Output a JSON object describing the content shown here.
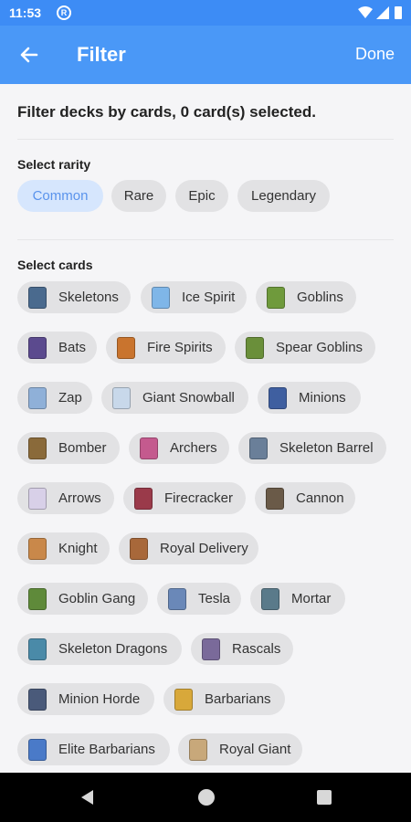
{
  "status_bar": {
    "time": "11:53"
  },
  "app_bar": {
    "title": "Filter",
    "done_label": "Done"
  },
  "filter_summary": "Filter decks by cards, 0 card(s) selected.",
  "rarity": {
    "label": "Select rarity",
    "options": [
      "Common",
      "Rare",
      "Epic",
      "Legendary"
    ],
    "selected": "Common"
  },
  "cards": {
    "label": "Select cards",
    "items": [
      {
        "name": "Skeletons",
        "icon": "skeletons-card-icon"
      },
      {
        "name": "Ice Spirit",
        "icon": "ice-spirit-card-icon"
      },
      {
        "name": "Goblins",
        "icon": "goblins-card-icon"
      },
      {
        "name": "Bats",
        "icon": "bats-card-icon"
      },
      {
        "name": "Fire Spirits",
        "icon": "fire-spirits-card-icon"
      },
      {
        "name": "Spear Goblins",
        "icon": "spear-goblins-card-icon"
      },
      {
        "name": "Zap",
        "icon": "zap-card-icon"
      },
      {
        "name": "Giant Snowball",
        "icon": "giant-snowball-card-icon"
      },
      {
        "name": "Minions",
        "icon": "minions-card-icon"
      },
      {
        "name": "Bomber",
        "icon": "bomber-card-icon"
      },
      {
        "name": "Archers",
        "icon": "archers-card-icon"
      },
      {
        "name": "Skeleton Barrel",
        "icon": "skeleton-barrel-card-icon"
      },
      {
        "name": "Arrows",
        "icon": "arrows-card-icon"
      },
      {
        "name": "Firecracker",
        "icon": "firecracker-card-icon"
      },
      {
        "name": "Cannon",
        "icon": "cannon-card-icon"
      },
      {
        "name": "Knight",
        "icon": "knight-card-icon"
      },
      {
        "name": "Royal Delivery",
        "icon": "royal-delivery-card-icon"
      },
      {
        "name": "Goblin Gang",
        "icon": "goblin-gang-card-icon"
      },
      {
        "name": "Tesla",
        "icon": "tesla-card-icon"
      },
      {
        "name": "Mortar",
        "icon": "mortar-card-icon"
      },
      {
        "name": "Skeleton Dragons",
        "icon": "skeleton-dragons-card-icon"
      },
      {
        "name": "Rascals",
        "icon": "rascals-card-icon"
      },
      {
        "name": "Minion Horde",
        "icon": "minion-horde-card-icon"
      },
      {
        "name": "Barbarians",
        "icon": "barbarians-card-icon"
      },
      {
        "name": "Elite Barbarians",
        "icon": "elite-barbarians-card-icon"
      },
      {
        "name": "Royal Giant",
        "icon": "royal-giant-card-icon"
      }
    ]
  },
  "colors": {
    "app_bar": "#4a98f7",
    "status_bar": "#3d8cf5",
    "chip": "#e2e2e4",
    "chip_selected_bg": "#d6e6fd",
    "chip_selected_text": "#5a93ec"
  }
}
